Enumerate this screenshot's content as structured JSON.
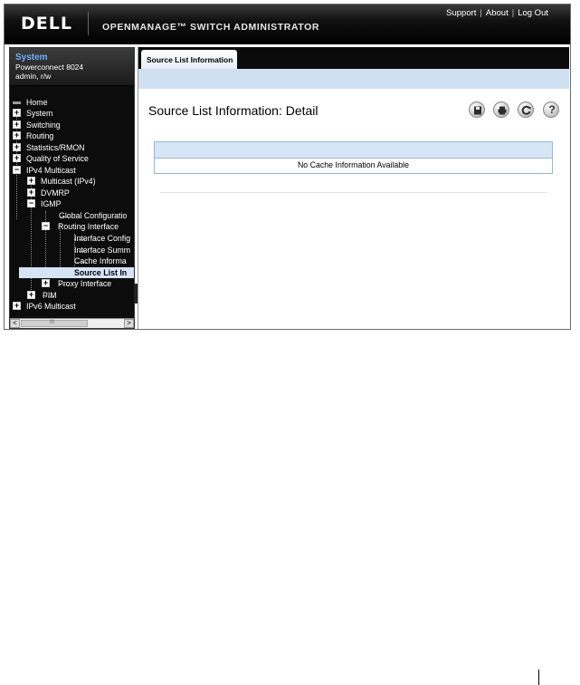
{
  "header": {
    "logo_text": "DELL",
    "product_title": "OPENMANAGE™ SWITCH ADMINISTRATOR",
    "links": [
      "Support",
      "About",
      "Log Out"
    ]
  },
  "system": {
    "title": "System",
    "model": "Powerconnect 8024",
    "user": "admin, r/w"
  },
  "tree": {
    "items": [
      "Home",
      "System",
      "Switching",
      "Routing",
      "Statistics/RMON",
      "Quality of Service",
      "IPv4 Multicast",
      "Multicast (IPv4)",
      "DVMRP",
      "IGMP",
      "Global Configuratio",
      "Routing Interface",
      "Interface Config",
      "Interface Summ",
      "Cache Informa",
      "Source List In",
      "Proxy Interface",
      "PIM",
      "IPv6 Multicast"
    ]
  },
  "scrollbar": {
    "left_arrow": "<",
    "grip": "III",
    "right_arrow": ">"
  },
  "content": {
    "tab_label": "Source List Information",
    "page_title": "Source List Information: Detail",
    "help_symbol": "?",
    "table_message": "No Cache Information Available"
  }
}
